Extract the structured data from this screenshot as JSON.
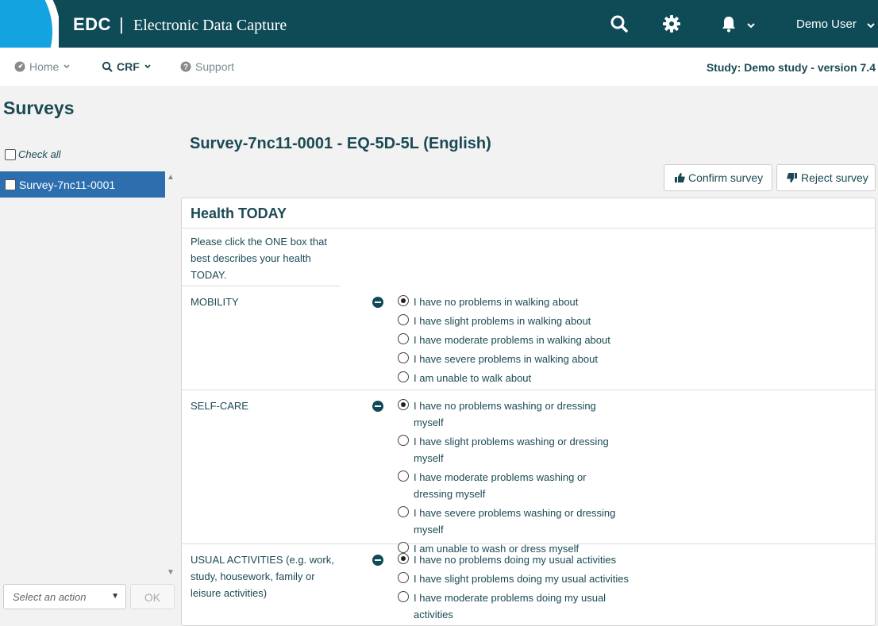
{
  "header": {
    "brand": "EDC",
    "separator": "|",
    "subtitle": "Electronic Data Capture",
    "user": "Demo User",
    "colors": {
      "bar": "#0f4a57",
      "accent": "#12a3e0"
    }
  },
  "nav": {
    "home": "Home",
    "crf": "CRF",
    "support": "Support",
    "study": "Study: Demo study - version 7.4"
  },
  "sidebar": {
    "title": "Surveys",
    "check_all": "Check all",
    "items": [
      {
        "label": "Survey-7nc11-0001",
        "selected": true
      }
    ],
    "select_action": "Select an action",
    "ok": "OK"
  },
  "main": {
    "title": "Survey-7nc11-0001 - EQ-5D-5L (English)",
    "confirm": "Confirm survey",
    "reject": "Reject survey",
    "panel_title": "Health TODAY",
    "intro": "Please click the ONE box that best describes your health TODAY.",
    "questions": [
      {
        "label": "MOBILITY",
        "options": [
          {
            "text": "I have no problems in walking about",
            "checked": true
          },
          {
            "text": "I have slight problems in walking about",
            "checked": false
          },
          {
            "text": "I have moderate problems in walking about",
            "checked": false
          },
          {
            "text": "I have severe problems in walking about",
            "checked": false
          },
          {
            "text": "I am unable to walk about",
            "checked": false
          }
        ]
      },
      {
        "label": "SELF-CARE",
        "options": [
          {
            "text": "I have no problems washing or dressing myself",
            "checked": true
          },
          {
            "text": "I have slight problems washing or dressing myself",
            "checked": false
          },
          {
            "text": "I have moderate problems washing or dressing myself",
            "checked": false
          },
          {
            "text": "I have severe problems washing or dressing myself",
            "checked": false
          },
          {
            "text": "I am unable to wash or dress myself",
            "checked": false
          }
        ]
      },
      {
        "label": "USUAL ACTIVITIES (e.g. work, study, housework, family or leisure activities)",
        "options": [
          {
            "text": "I have no problems doing my usual activities",
            "checked": true
          },
          {
            "text": "I have slight problems doing my usual activities",
            "checked": false
          },
          {
            "text": "I have moderate problems doing my usual activities",
            "checked": false
          }
        ]
      }
    ]
  }
}
